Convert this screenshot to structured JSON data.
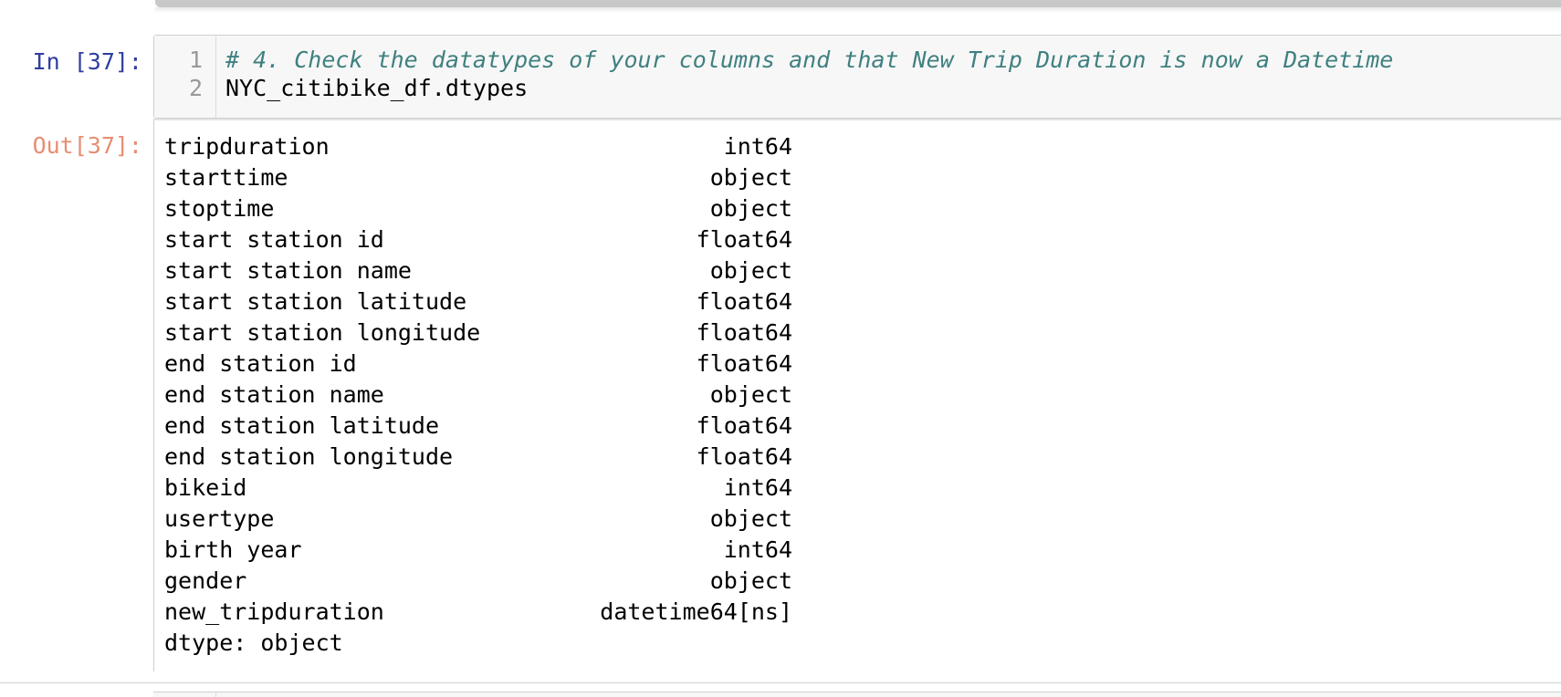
{
  "input_cell": {
    "prompt": "In [37]:",
    "lines": [
      {
        "number": "1",
        "text": "# 4. Check the datatypes of your columns and that New Trip Duration is now a Datetime"
      },
      {
        "number": "2",
        "text": "NYC_citibike_df.dtypes"
      }
    ]
  },
  "output_cell": {
    "prompt": "Out[37]:",
    "rows": [
      {
        "name": "tripduration",
        "dtype": "int64"
      },
      {
        "name": "starttime",
        "dtype": "object"
      },
      {
        "name": "stoptime",
        "dtype": "object"
      },
      {
        "name": "start station id",
        "dtype": "float64"
      },
      {
        "name": "start station name",
        "dtype": "object"
      },
      {
        "name": "start station latitude",
        "dtype": "float64"
      },
      {
        "name": "start station longitude",
        "dtype": "float64"
      },
      {
        "name": "end station id",
        "dtype": "float64"
      },
      {
        "name": "end station name",
        "dtype": "object"
      },
      {
        "name": "end station latitude",
        "dtype": "float64"
      },
      {
        "name": "end station longitude",
        "dtype": "float64"
      },
      {
        "name": "bikeid",
        "dtype": "int64"
      },
      {
        "name": "usertype",
        "dtype": "object"
      },
      {
        "name": "birth year",
        "dtype": "int64"
      },
      {
        "name": "gender",
        "dtype": "object"
      },
      {
        "name": "new_tripduration",
        "dtype": "datetime64[ns]"
      }
    ],
    "footer": "dtype: object"
  },
  "colors": {
    "in_prompt": "#303f9f",
    "out_prompt": "#d84315",
    "comment": "#408080",
    "cell_background": "#f7f7f7"
  }
}
